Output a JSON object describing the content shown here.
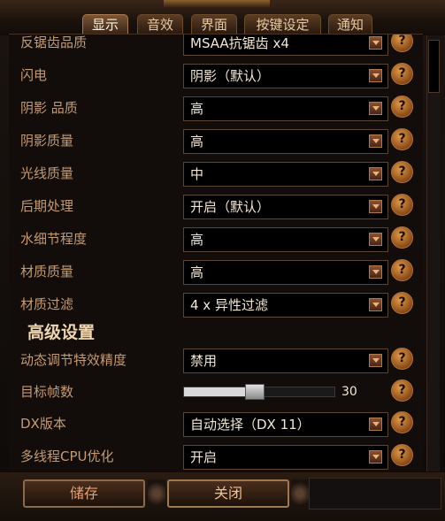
{
  "tabs": [
    {
      "label": "显示",
      "active": true
    },
    {
      "label": "音效",
      "active": false
    },
    {
      "label": "界面",
      "active": false
    },
    {
      "label": "按键设定",
      "active": false
    },
    {
      "label": "通知",
      "active": false
    }
  ],
  "settings": [
    {
      "label": "反锯齿品质",
      "value": "MSAA抗锯齿 x4"
    },
    {
      "label": "闪电",
      "value": "阴影（默认）"
    },
    {
      "label": "阴影 品质",
      "value": "高"
    },
    {
      "label": "阴影质量",
      "value": "高"
    },
    {
      "label": "光线质量",
      "value": "中"
    },
    {
      "label": "后期处理",
      "value": "开启（默认）"
    },
    {
      "label": "水细节程度",
      "value": "高"
    },
    {
      "label": "材质质量",
      "value": "高"
    },
    {
      "label": "材质过滤",
      "value": "4 x 异性过滤"
    }
  ],
  "advanced": {
    "title": "高级设置",
    "dynamic_effects": {
      "label": "动态调节特效精度",
      "value": "禁用"
    },
    "target_fps": {
      "label": "目标帧数",
      "value": "30",
      "level": 0.47
    },
    "dx_version": {
      "label": "DX版本",
      "value": "自动选择（DX 11）"
    },
    "multithread": {
      "label": "多线程CPU优化",
      "value": "开启"
    }
  },
  "help_icon": "?",
  "buttons": {
    "save": "储存",
    "close": "关闭"
  },
  "colors": {
    "accent": "#c49a74",
    "value_text": "#f2e6d6",
    "section_title": "#f0d6b0"
  }
}
